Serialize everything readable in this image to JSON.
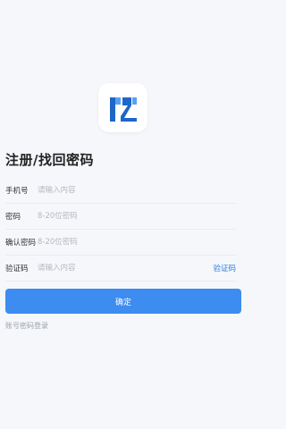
{
  "logo": {
    "icon": "app-logo-icon",
    "colors": {
      "dark": "#1e66c8",
      "light": "#5aa0ef"
    }
  },
  "page_title": "注册/找回密码",
  "form": {
    "phone": {
      "label": "手机号",
      "placeholder": "请输入内容"
    },
    "password": {
      "label": "密码",
      "placeholder": "8-20位密码"
    },
    "confirm": {
      "label": "确认密码",
      "placeholder": "8-20位密码"
    },
    "code": {
      "label": "验证码",
      "placeholder": "请输入内容",
      "send_label": "验证码"
    }
  },
  "submit_label": "确定",
  "switch_link": "账号密码登录",
  "colors": {
    "accent": "#3d8cf0",
    "background": "#f6f7fb"
  }
}
